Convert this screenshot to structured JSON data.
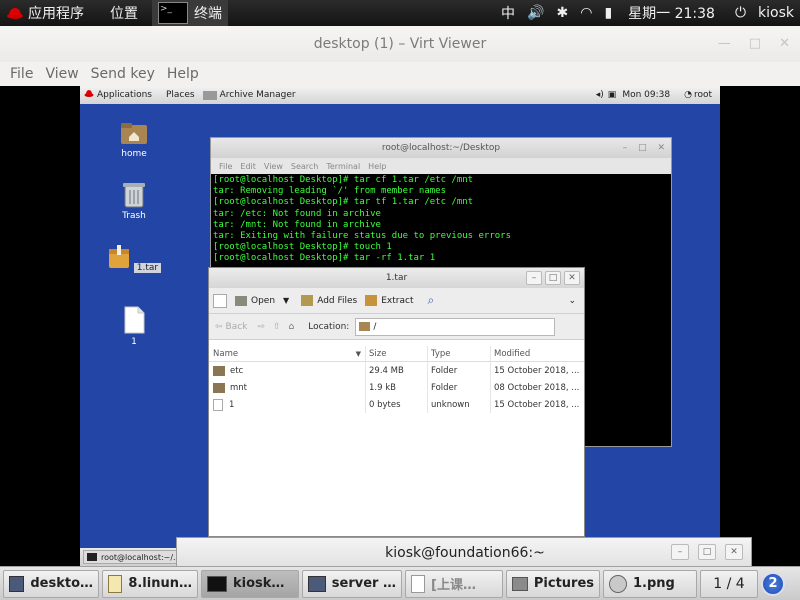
{
  "topbar": {
    "apps_label": "应用程序",
    "places_label": "位置",
    "terminal_label": "终端",
    "ime": "中",
    "clock": "星期一 21:38",
    "user": "kiosk"
  },
  "viewer": {
    "title": "desktop (1) – Virt Viewer",
    "menu": [
      "File",
      "View",
      "Send key",
      "Help"
    ]
  },
  "guest": {
    "panel": {
      "applications": "Applications",
      "places": "Places",
      "app_name": "Archive Manager",
      "clock": "Mon 09:38",
      "user": "root"
    },
    "desktop_icons": [
      {
        "label": "home",
        "icon": "home-folder-icon"
      },
      {
        "label": "Trash",
        "icon": "trash-icon"
      },
      {
        "label": "1.tar",
        "icon": "package-icon"
      },
      {
        "label": "1",
        "icon": "file-icon"
      }
    ],
    "terminal": {
      "title": "root@localhost:~/Desktop",
      "menu": [
        "File",
        "Edit",
        "View",
        "Search",
        "Terminal",
        "Help"
      ],
      "lines": [
        "[root@localhost Desktop]# tar cf 1.tar /etc /mnt",
        "tar: Removing leading `/' from member names",
        "[root@localhost Desktop]# tar tf 1.tar /etc /mnt",
        "tar: /etc: Not found in archive",
        "tar: /mnt: Not found in archive",
        "tar: Exiting with failure status due to previous errors",
        "[root@localhost Desktop]# touch 1",
        "[root@localhost Desktop]# tar -rf 1.tar 1"
      ]
    },
    "archive": {
      "title": "1.tar",
      "open_label": "Open",
      "add_files_label": "Add Files",
      "extract_label": "Extract",
      "back_label": "Back",
      "location_label": "Location:",
      "location_value": "/",
      "columns": [
        "Name",
        "Size",
        "Type",
        "Modified"
      ],
      "rows": [
        {
          "name": "etc",
          "size": "29.4 MB",
          "type": "Folder",
          "modified": "15 October 2018, ..."
        },
        {
          "name": "mnt",
          "size": "1.9 kB",
          "type": "Folder",
          "modified": "08 October 2018, ..."
        },
        {
          "name": "1",
          "size": "0 bytes",
          "type": "unknown",
          "modified": "15 October 2018, ..."
        }
      ]
    },
    "taskbar_item": "root@localhost:~/..."
  },
  "host_terminal_title": "kiosk@foundation66:~",
  "taskbar": {
    "items": [
      {
        "label": "deskto…",
        "icon": "monitor-icon"
      },
      {
        "label": "8.linun…",
        "icon": "editor-icon"
      },
      {
        "label": "kiosk…",
        "icon": "terminal-icon"
      },
      {
        "label": "server …",
        "icon": "monitor-icon"
      },
      {
        "label": "[上课…",
        "icon": "document-icon"
      },
      {
        "label": "Pictures",
        "icon": "folder-icon"
      },
      {
        "label": "1.png",
        "icon": "image-viewer-icon"
      }
    ],
    "workspace": "1 / 4",
    "badge": "2"
  },
  "colors": {
    "guest_desktop": "#2346a6",
    "terminal_text": "#3cff3c",
    "host_panel": "#1a1a1a"
  }
}
